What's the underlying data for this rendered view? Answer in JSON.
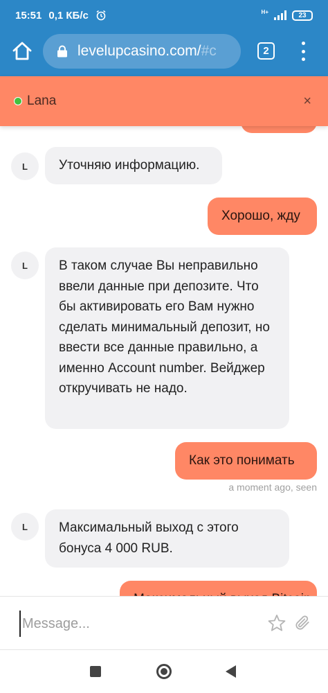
{
  "status_bar": {
    "time": "15:51",
    "speed": "0,1 КБ/с",
    "network": "H+",
    "battery": "23"
  },
  "browser": {
    "url_main": "levelupcasino.com/",
    "url_hash": "#c",
    "tab_count": "2",
    "colors": {
      "toolbar": "#2c87c7",
      "url_bar": "#5a9fd3"
    }
  },
  "chat": {
    "agent_name": "Lana",
    "status": "online",
    "close_label": "×",
    "accent_color": "#ff8765",
    "avatar_initial": "L",
    "messages": [
      {
        "from": "agent",
        "text": "Уточняю информацию."
      },
      {
        "from": "user",
        "text": "Хорошо, жду"
      },
      {
        "from": "agent",
        "text": "В таком случае Вы неправильно ввели данные при депозите. Что бы активировать его Вам нужно сделать минимальный депозит, но ввести все данные правильно, а именно Account number. Вейджер откручивать не надо."
      },
      {
        "from": "user",
        "text": "Как это понимать",
        "meta": "a moment ago, seen"
      },
      {
        "from": "agent",
        "text": "Максимальный выход с этого бонуса 4 000 RUB."
      },
      {
        "from": "user",
        "text": "Максимальный выход Bitcoin"
      }
    ],
    "composer": {
      "placeholder": "Message...",
      "value": ""
    }
  }
}
